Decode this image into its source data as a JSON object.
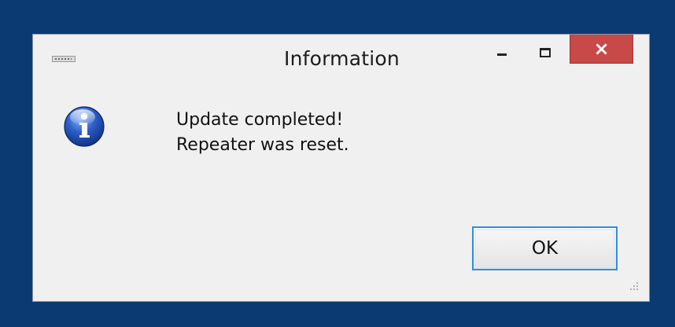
{
  "window": {
    "title": "Information",
    "close_glyph": "×",
    "system_menu_icon": "app-menu-icon",
    "minimize_icon": "minimize-icon",
    "maximize_icon": "maximize-icon",
    "close_icon": "close-icon"
  },
  "content": {
    "icon": "info-icon",
    "message_lines": [
      "Update completed!",
      "Repeater was reset."
    ]
  },
  "buttons": {
    "ok_label": "OK"
  },
  "colors": {
    "desktop_background": "#0b3a72",
    "dialog_background": "#f0f0f0",
    "close_button": "#c84947",
    "focus_border": "#2f8ee0",
    "info_icon_blue": "#1f4da8"
  }
}
